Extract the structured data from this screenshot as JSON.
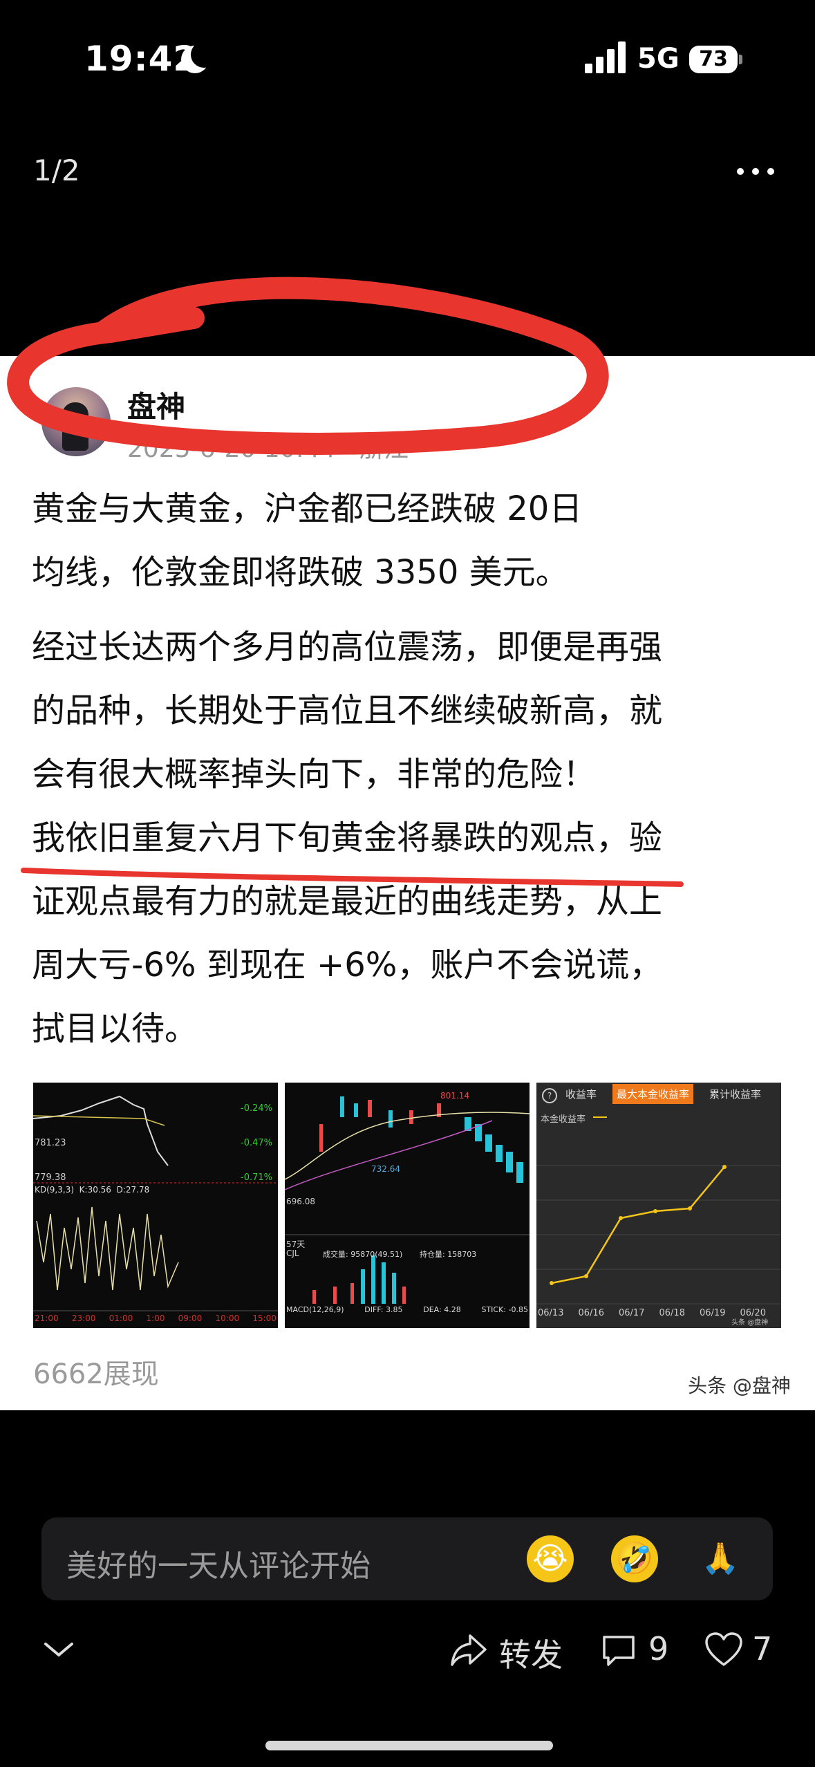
{
  "status": {
    "time": "19:42",
    "network": "5G",
    "battery": "73"
  },
  "viewer": {
    "page_index": "1/2"
  },
  "post": {
    "author": "盘神",
    "date": "2025-6-20 10:44",
    "location": "浙江",
    "paragraphs": [
      "黄金与大黄金，沪金都已经跌破 20日\n均线，伦敦金即将跌破 3350 美元。",
      "经过长达两个多月的高位震荡，即便是再强\n的品种，长期处于高位且不继续破新高，就\n会有很大概率掉头向下，非常的危险！\n我依旧重复六月下旬黄金将暴跌的观点，验\n证观点最有力的就是最近的曲线走势，从上\n周大亏-6% 到现在 +6%，账户不会说谎，\n拭目以待。"
    ],
    "views": "6662展现",
    "watermark": "头条 @盘神"
  },
  "thumb1": {
    "p1": "781.23",
    "p2": "779.38",
    "pct1": "-0.24%",
    "pct2": "-0.47%",
    "pct3": "-0.71%",
    "kd": "KD(9,3,3)",
    "k": "K:30.56",
    "d": "D:27.78",
    "xticks": [
      "21:00",
      "23:00",
      "01:00",
      "1:00",
      "09:00",
      "10:00",
      "15:00"
    ]
  },
  "thumb2": {
    "hi": "801.14",
    "lo": "732.64",
    "left": "696.08",
    "days": "57天",
    "cjl": "CJL",
    "vol": "成交量: 95870(49.51)",
    "oi": "持仓量: 158703",
    "macd": "MACD(12,26,9)",
    "diff": "DIFF: 3.85",
    "dea": "DEA: 4.28",
    "stick": "STICK: -0.85"
  },
  "thumb3": {
    "tabs": [
      "收益率",
      "最大本金收益率",
      "累计收益率"
    ],
    "legend": "本金收益率",
    "dates": [
      "06/13",
      "06/16",
      "06/17",
      "06/18",
      "06/19",
      "06/20"
    ],
    "wm": "头条 @盘神"
  },
  "comment": {
    "placeholder": "美好的一天从评论开始"
  },
  "actions": {
    "share": "转发",
    "comments": "9",
    "likes": "7"
  }
}
